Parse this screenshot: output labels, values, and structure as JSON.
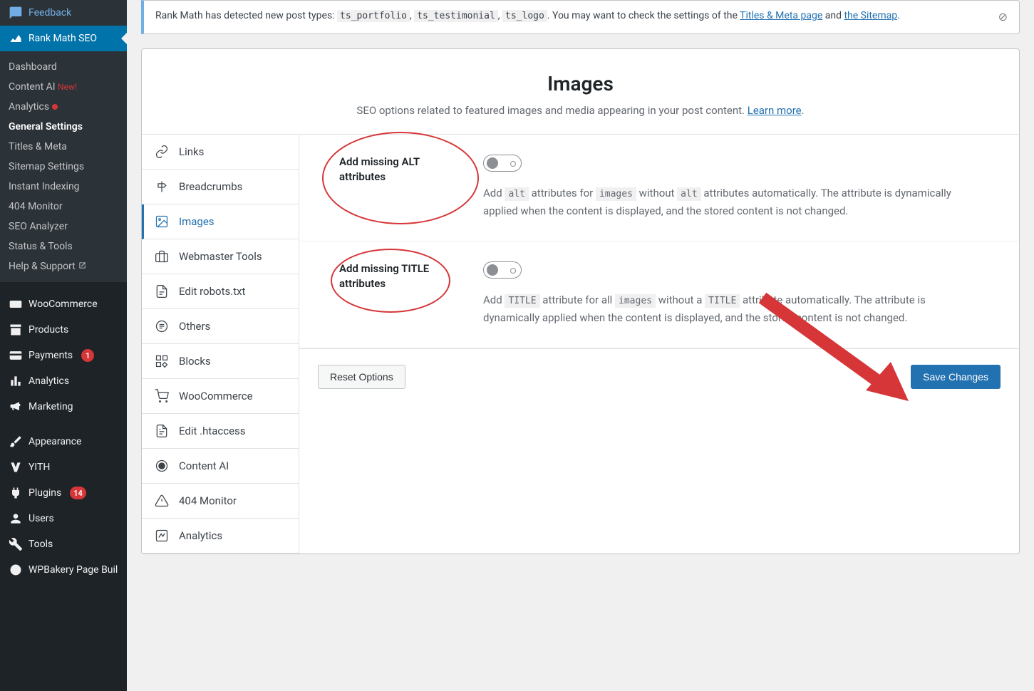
{
  "sidebar": {
    "feedback": "Feedback",
    "rankmath": "Rank Math SEO",
    "submenu": {
      "dashboard": "Dashboard",
      "content_ai": "Content AI",
      "content_ai_new": "New!",
      "analytics": "Analytics",
      "general": "General Settings",
      "titles": "Titles & Meta",
      "sitemap": "Sitemap Settings",
      "instant": "Instant Indexing",
      "monitor404": "404 Monitor",
      "seo_analyzer": "SEO Analyzer",
      "status": "Status & Tools",
      "help": "Help & Support"
    },
    "woocommerce": "WooCommerce",
    "products": "Products",
    "payments": "Payments",
    "payments_badge": "1",
    "analytics2": "Analytics",
    "marketing": "Marketing",
    "appearance": "Appearance",
    "yith": "YITH",
    "plugins": "Plugins",
    "plugins_badge": "14",
    "users": "Users",
    "tools": "Tools",
    "wpbakery": "WPBakery Page Builder"
  },
  "notice": {
    "text_prefix": "Rank Math has detected new post types: ",
    "code1": "ts_portfolio",
    "code2": "ts_testimonial",
    "code3": "ts_logo",
    "text_mid1": ". You may want to check the settings of the ",
    "link1": "Titles & Meta page",
    "text_and": " and ",
    "link2": "the Sitemap",
    "text_period": "."
  },
  "panel": {
    "title": "Images",
    "subtitle": "SEO options related to featured images and media appearing in your post content. ",
    "learn_more": "Learn more",
    "period": "."
  },
  "tabs": {
    "links": "Links",
    "breadcrumbs": "Breadcrumbs",
    "images": "Images",
    "webmaster": "Webmaster Tools",
    "robots": "Edit robots.txt",
    "others": "Others",
    "blocks": "Blocks",
    "woocommerce": "WooCommerce",
    "htaccess": "Edit .htaccess",
    "content_ai": "Content AI",
    "monitor404": "404 Monitor",
    "analytics": "Analytics"
  },
  "settings": {
    "alt": {
      "label": "Add missing ALT attributes",
      "desc_p1": "Add ",
      "desc_c1": "alt",
      "desc_p2": " attributes for ",
      "desc_c2": "images",
      "desc_p3": " without ",
      "desc_c3": "alt",
      "desc_p4": " attributes automatically. The attribute is dynamically applied when the content is displayed, and the stored content is not changed."
    },
    "title": {
      "label": "Add missing TITLE attributes",
      "desc_p1": "Add ",
      "desc_c1": "TITLE",
      "desc_p2": " attribute for all ",
      "desc_c2": "images",
      "desc_p3": " without a ",
      "desc_c3": "TITLE",
      "desc_p4": " attribute automatically. The attribute is dynamically applied when the content is displayed, and the stored content is not changed."
    }
  },
  "footer": {
    "reset": "Reset Options",
    "save": "Save Changes"
  }
}
